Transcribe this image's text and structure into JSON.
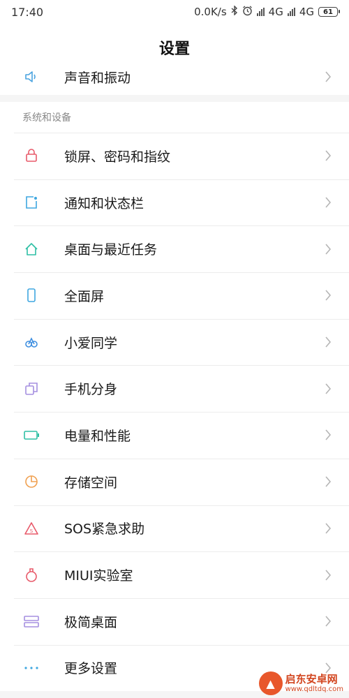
{
  "status_bar": {
    "time": "17:40",
    "speed": "0.0K/s",
    "network1": "4G",
    "network2": "4G",
    "battery": "61"
  },
  "header": {
    "title": "设置"
  },
  "partial_item": {
    "label": "声音和振动",
    "icon": "speaker-icon",
    "color": "#4aa3df"
  },
  "section": {
    "title": "系统和设备"
  },
  "items": [
    {
      "label": "锁屏、密码和指纹",
      "icon": "lock-icon",
      "color": "#e85a6a"
    },
    {
      "label": "通知和状态栏",
      "icon": "notification-icon",
      "color": "#3fa7e0"
    },
    {
      "label": "桌面与最近任务",
      "icon": "home-icon",
      "color": "#2fbfa5"
    },
    {
      "label": "全面屏",
      "icon": "phone-icon",
      "color": "#3fa7e0"
    },
    {
      "label": "小爱同学",
      "icon": "xiaoai-icon",
      "color": "#3f8fe0"
    },
    {
      "label": "手机分身",
      "icon": "dual-phone-icon",
      "color": "#a58fe0"
    },
    {
      "label": "电量和性能",
      "icon": "battery-icon",
      "color": "#2fbfa5"
    },
    {
      "label": "存储空间",
      "icon": "pie-chart-icon",
      "color": "#f0a050"
    },
    {
      "label": "SOS紧急求助",
      "icon": "sos-icon",
      "color": "#e85a6a"
    },
    {
      "label": "MIUI实验室",
      "icon": "flask-icon",
      "color": "#e85a6a"
    },
    {
      "label": "极简桌面",
      "icon": "minimal-desktop-icon",
      "color": "#a58fe0"
    },
    {
      "label": "更多设置",
      "icon": "more-icon",
      "color": "#3fa7e0"
    }
  ],
  "watermark": {
    "name": "启东安卓网",
    "url": "www.qdltdq.com"
  }
}
